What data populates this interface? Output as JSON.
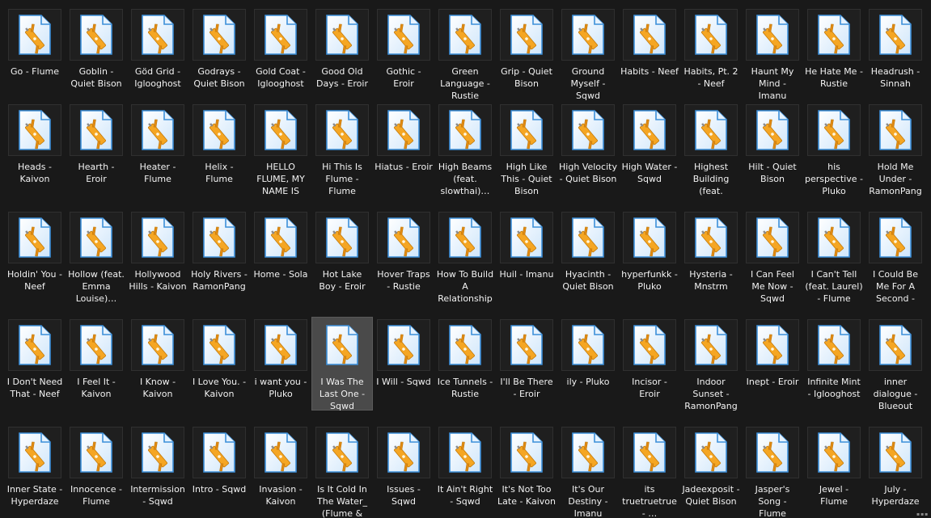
{
  "files": [
    "Go - Flume",
    "Goblin - Quiet Bison",
    "Göd Grid - Iglooghost",
    "Godrays - Quiet Bison",
    "Gold Coat - Iglooghost",
    "Good Old Days - Eroir",
    "Gothic - Eroir",
    "Green Language - Rustie",
    "Grip - Quiet Bison",
    "Ground Myself - Sqwd",
    "Habits - Neef",
    "Habits, Pt. 2 - Neef",
    "Haunt My Mind - Imanu",
    "He Hate Me - Rustie",
    "Headrush - Sinnah",
    "Heads - Kaivon",
    "Hearth - Eroir",
    "Heater - Flume",
    "Helix - Flume",
    "HELLO FLUME, MY NAME IS GRANT - …",
    "Hi This Is Flume - Flume",
    "Hiatus - Eroir",
    "High Beams (feat. slowthai)…",
    "High Like This - Quiet Bison",
    "High Velocity - Quiet Bison",
    "High Water - Sqwd",
    "Highest Building (feat. Oklou)…",
    "Hilt - Quiet Bison",
    "his perspective - Pluko",
    "Hold Me Under - RamonPang",
    "Holdin' You - Neef",
    "Hollow (feat. Emma Louise)…",
    "Hollywood Hills - Kaivon",
    "Holy Rivers - RamonPang",
    "Home - Sola",
    "Hot Lake Boy - Eroir",
    "Hover Traps - Rustie",
    "How To Build A Relationship (feat. JP…",
    "Huil - Imanu",
    "Hyacinth - Quiet Bison",
    "hyperfunkk - Pluko",
    "Hysteria - Mnstrm",
    "I Can Feel Me Now - Sqwd",
    "I Can't Tell (feat. Laurel) - Flume",
    "I Could Be Me For A Second - Sqwd",
    "I Don't Need That - Neef",
    "I Feel It - Kaivon",
    "I Know - Kaivon",
    "I Love You. - Kaivon",
    "i want you - Pluko",
    "I Was The Last One - Sqwd",
    "I Will - Sqwd",
    "Ice Tunnels - Rustie",
    "I'll Be There - Eroir",
    "ily - Pluko",
    "Incisor - Eroir",
    "Indoor Sunset - RamonPang",
    "Inept - Eroir",
    "Infinite Mint - Iglooghost",
    "inner dialogue - Blueout",
    "Inner State - Hyperdaze",
    "Innocence - Flume",
    "Intermission - Sqwd",
    "Intro - Sqwd",
    "Invasion - Kaivon",
    "Is It Cold In The Water_ (Flume &",
    "Issues - Sqwd",
    "It Ain't Right - Sqwd",
    "It's Not Too Late - Kaivon",
    "It's Our Destiny - Imanu",
    "its truetruetrue - …",
    "Jadeexposit - Quiet Bison",
    "Jasper's Song - Flume",
    "Jewel - Flume",
    "July - Hyperdaze"
  ],
  "selected_file": "I Was The Last One - Sqwd",
  "file_icon": "audio-file-icon",
  "colors": {
    "background": "#191919",
    "text": "#f2f2f2",
    "selection": "#4a4a4a",
    "icon_orange": "#f5a623",
    "icon_blue": "#3c8fd9"
  }
}
